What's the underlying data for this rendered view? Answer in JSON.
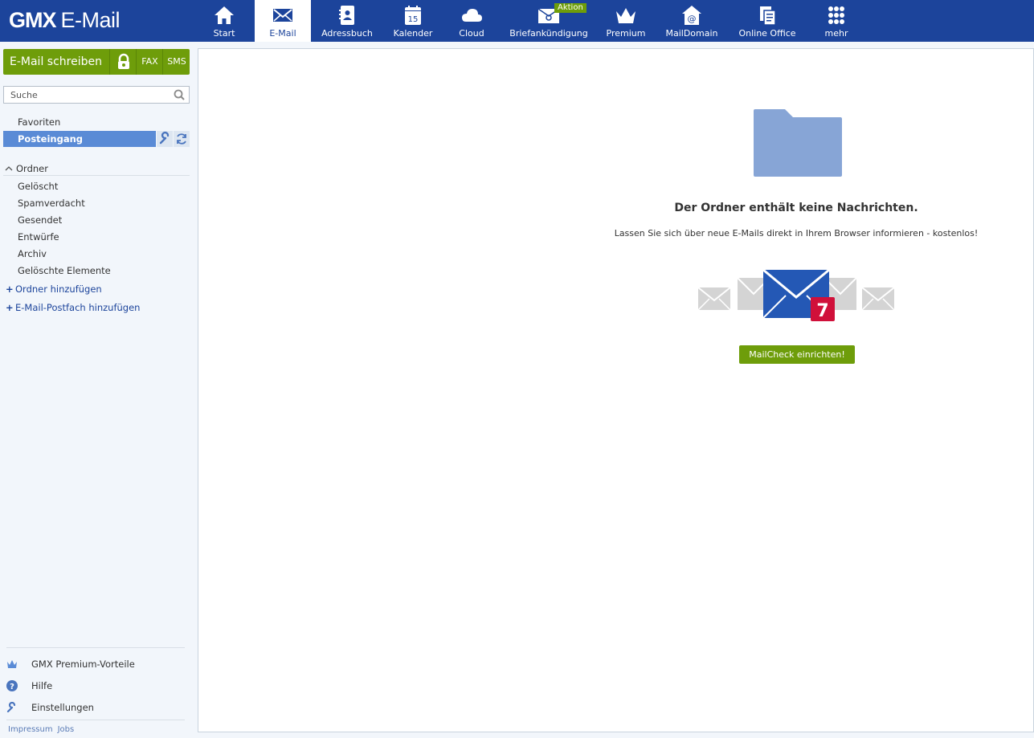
{
  "app": {
    "logo_brand": "GMX",
    "logo_product": "E-Mail"
  },
  "nav": [
    {
      "label": "Start",
      "icon": "home-icon"
    },
    {
      "label": "E-Mail",
      "icon": "mail-icon",
      "active": true
    },
    {
      "label": "Adressbuch",
      "icon": "contacts-icon"
    },
    {
      "label": "Kalender",
      "icon": "calendar-icon",
      "day": "15"
    },
    {
      "label": "Cloud",
      "icon": "cloud-icon"
    },
    {
      "label": "Briefankündigung",
      "icon": "letter-icon",
      "badge": "Aktion"
    },
    {
      "label": "Premium",
      "icon": "crown-icon"
    },
    {
      "label": "MailDomain",
      "icon": "maildomain-icon"
    },
    {
      "label": "Online Office",
      "icon": "office-icon"
    },
    {
      "label": "mehr",
      "icon": "grid-icon"
    }
  ],
  "sidebar": {
    "compose_label": "E-Mail schreiben",
    "fax_label": "FAX",
    "sms_label": "SMS",
    "search_placeholder": "Suche",
    "favorites": "Favoriten",
    "inbox": "Posteingang",
    "folders_header": "Ordner",
    "folders": [
      "Gelöscht",
      "Spamverdacht",
      "Gesendet",
      "Entwürfe",
      "Archiv",
      "Gelöschte Elemente"
    ],
    "add_folder": "Ordner hinzufügen",
    "add_mailbox": "E-Mail-Postfach hinzufügen",
    "bottom": [
      "GMX Premium-Vorteile",
      "Hilfe",
      "Einstellungen"
    ],
    "footer": [
      "Impressum",
      "Jobs"
    ]
  },
  "main": {
    "empty_title": "Der Ordner enthält keine Nachrichten.",
    "empty_sub": "Lassen Sie sich über neue E-Mails direkt in Ihrem Browser informieren - kostenlos!",
    "notification_count": "7",
    "mailcheck_button": "MailCheck einrichten!"
  },
  "colors": {
    "header": "#1c449b",
    "accent_green": "#6e9d0a",
    "selected": "#5a8bd6",
    "badge_red": "#d0103a"
  }
}
